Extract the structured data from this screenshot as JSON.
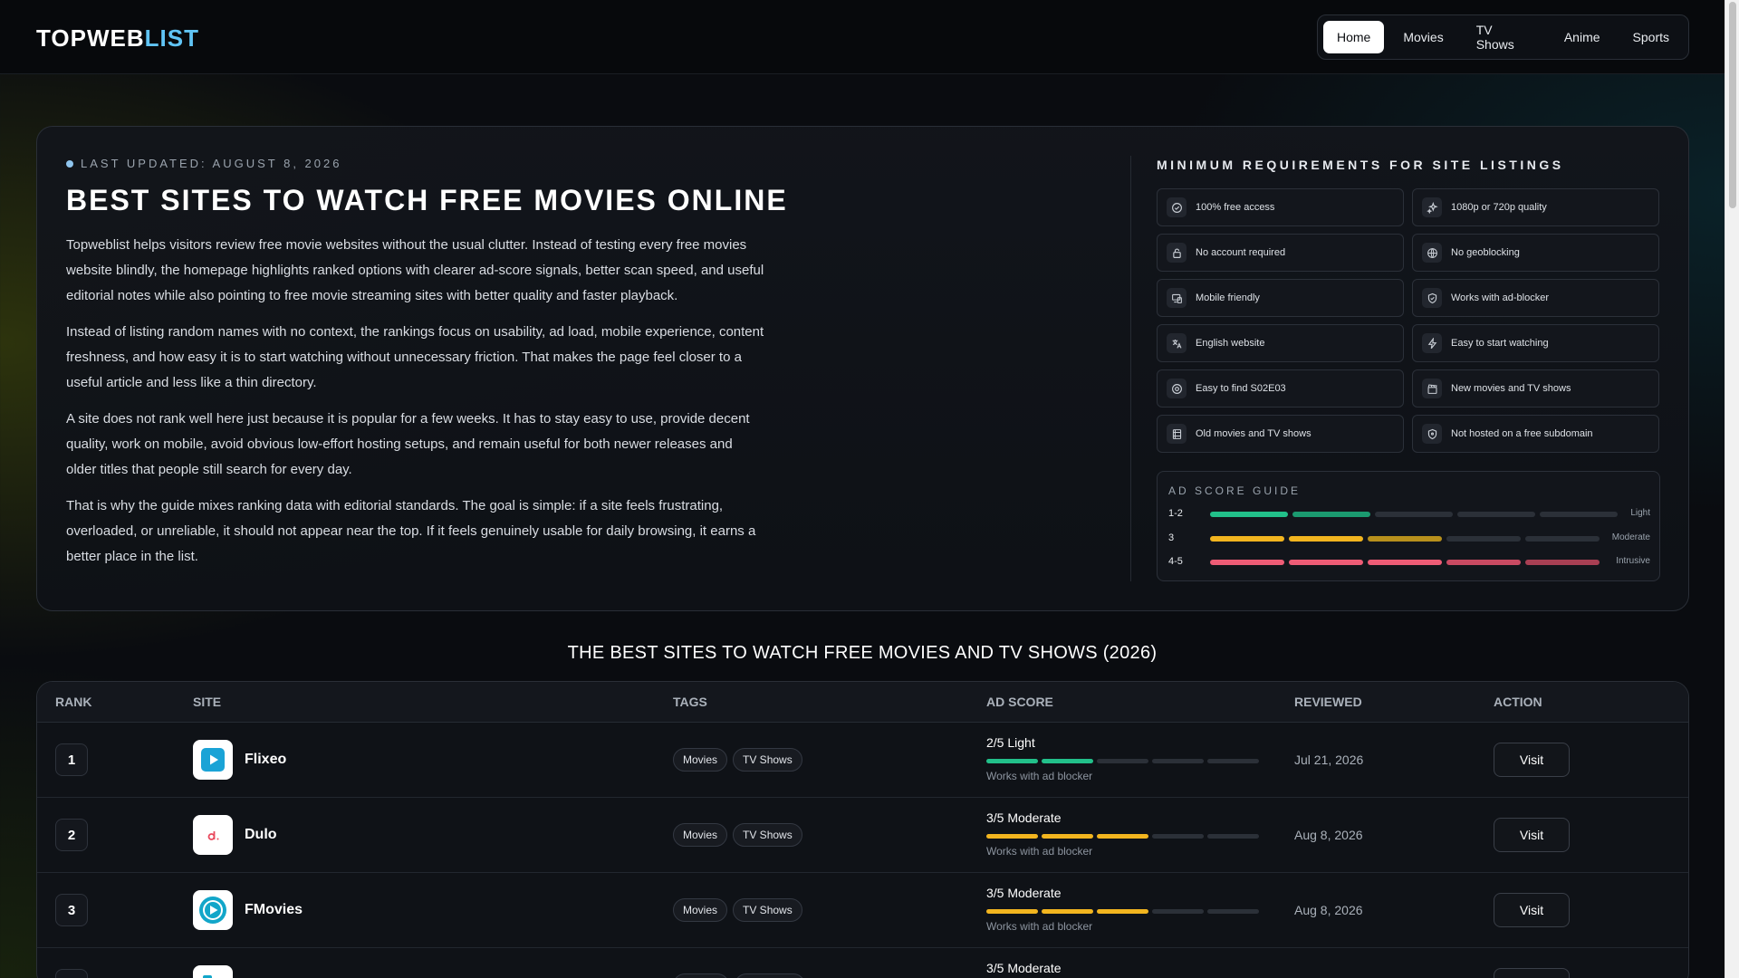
{
  "header": {
    "logo_main": "TOPWEB",
    "logo_accent": "LIST",
    "nav": [
      {
        "label": "Home",
        "active": true
      },
      {
        "label": "Movies",
        "active": false
      },
      {
        "label": "TV Shows",
        "active": false
      },
      {
        "label": "Anime",
        "active": false
      },
      {
        "label": "Sports",
        "active": false
      }
    ]
  },
  "hero": {
    "updated": "LAST UPDATED: AUGUST 8, 2026",
    "title": "BEST SITES TO WATCH FREE MOVIES ONLINE",
    "paragraphs": [
      "Topweblist helps visitors review free movie websites without the usual clutter. Instead of testing every free movies website blindly, the homepage highlights ranked options with clearer ad-score signals, better scan speed, and useful editorial notes while also pointing to free movie streaming sites with better quality and faster playback.",
      "Instead of listing random names with no context, the rankings focus on usability, ad load, mobile experience, content freshness, and how easy it is to start watching without unnecessary friction. That makes the page feel closer to a useful article and less like a thin directory.",
      "A site does not rank well here just because it is popular for a few weeks. It has to stay easy to use, provide decent quality, work on mobile, avoid obvious low-effort hosting setups, and remain useful for both newer releases and older titles that people still search for every day.",
      "That is why the guide mixes ranking data with editorial standards. The goal is simple: if a site feels frustrating, overloaded, or unreliable, it should not appear near the top. If it feels genuinely usable for daily browsing, it earns a better place in the list."
    ]
  },
  "requirements": {
    "title": "MINIMUM REQUIREMENTS FOR SITE LISTINGS",
    "items": [
      {
        "label": "100% free access",
        "icon": "check-circle-icon"
      },
      {
        "label": "1080p or 720p quality",
        "icon": "sparkle-icon"
      },
      {
        "label": "No account required",
        "icon": "lock-icon"
      },
      {
        "label": "No geoblocking",
        "icon": "globe-icon"
      },
      {
        "label": "Mobile friendly",
        "icon": "devices-icon"
      },
      {
        "label": "Works with ad-blocker",
        "icon": "shield-check-icon"
      },
      {
        "label": "English website",
        "icon": "language-icon"
      },
      {
        "label": "Easy to start watching",
        "icon": "lightning-icon"
      },
      {
        "label": "Easy to find S02E03",
        "icon": "target-icon"
      },
      {
        "label": "New movies and TV shows",
        "icon": "clapperboard-icon"
      },
      {
        "label": "Old movies and TV shows",
        "icon": "film-icon"
      },
      {
        "label": "Not hosted on a free subdomain",
        "icon": "shield-icon"
      }
    ]
  },
  "ad_guide": {
    "title": "AD SCORE GUIDE",
    "rows": [
      {
        "range": "1-2",
        "tag": "Light",
        "filled": 2,
        "colors": [
          "#22c08a",
          "#1b9a70"
        ]
      },
      {
        "range": "3",
        "tag": "Moderate",
        "filled": 3,
        "colors": [
          "#f2b51f",
          "#f2b51f",
          "#b8901c"
        ]
      },
      {
        "range": "4-5",
        "tag": "Intrusive",
        "filled": 5,
        "colors": [
          "#ee5c76",
          "#ee5c76",
          "#ee5c76",
          "#c94a62",
          "#a83f53"
        ]
      }
    ]
  },
  "table": {
    "section_title": "THE BEST SITES TO WATCH FREE MOVIES AND TV SHOWS (2026)",
    "headers": [
      "RANK",
      "SITE",
      "TAGS",
      "AD SCORE",
      "REVIEWED",
      "ACTION"
    ],
    "rows": [
      {
        "rank": "1",
        "name": "Flixeo",
        "tags": [
          "Movies",
          "TV Shows"
        ],
        "score_label": "2/5 Light",
        "score": 2,
        "score_color": "#22c08a",
        "note": "Works with ad blocker",
        "reviewed": "Jul 21, 2026",
        "action": "Visit",
        "logo": "play-square-icon"
      },
      {
        "rank": "2",
        "name": "Dulo",
        "tags": [
          "Movies",
          "TV Shows"
        ],
        "score_label": "3/5 Moderate",
        "score": 3,
        "score_color": "#f2b51f",
        "note": "Works with ad blocker",
        "reviewed": "Aug 8, 2026",
        "action": "Visit",
        "logo": "dulo-logo-icon"
      },
      {
        "rank": "3",
        "name": "FMovies",
        "tags": [
          "Movies",
          "TV Shows"
        ],
        "score_label": "3/5 Moderate",
        "score": 3,
        "score_color": "#f2b51f",
        "note": "Works with ad blocker",
        "reviewed": "Aug 8, 2026",
        "action": "Visit",
        "logo": "play-circle-icon"
      },
      {
        "rank": "",
        "name": "",
        "tags": [
          "",
          ""
        ],
        "score_label": "3/5 Moderate",
        "score": 3,
        "score_color": "#f2b51f",
        "note": "",
        "reviewed": "",
        "action": "",
        "logo": "partial-logo-icon"
      }
    ]
  }
}
